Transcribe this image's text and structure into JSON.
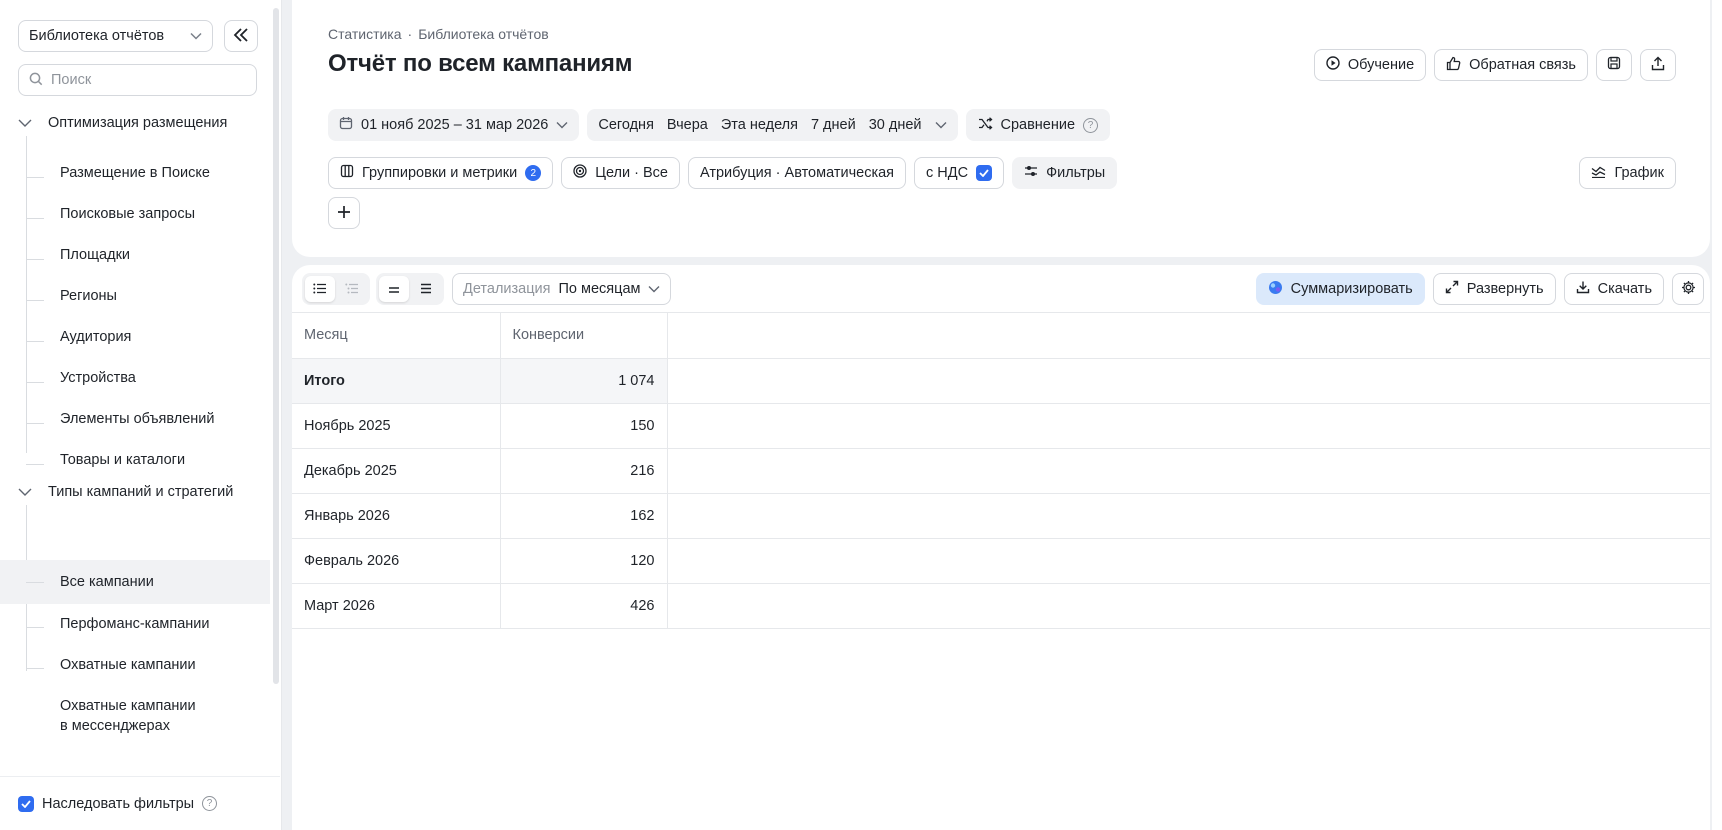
{
  "sidebar": {
    "library_select": "Библиотека отчётов",
    "search_placeholder": "Поиск",
    "groups": [
      {
        "title": "Оптимизация размещения",
        "items": [
          "Размещение в Поиске",
          "Поисковые запросы",
          "Площадки",
          "Регионы",
          "Аудитория",
          "Устройства",
          "Элементы объявлений",
          "Товары и каталоги"
        ]
      },
      {
        "title": "Типы кампаний и стратегий",
        "items": [
          "Все кампании",
          "Перфоманс-кампании",
          "Охватные кампании",
          "Охватные кампании в мессенджерах"
        ],
        "active_item": "Все кампании"
      }
    ],
    "item_multiline": [
      "Охватные кампании",
      "в мессенджерах"
    ],
    "footer_label": "Наследовать фильтры"
  },
  "header": {
    "breadcrumb": [
      "Статистика",
      "·",
      "Библиотека отчётов"
    ],
    "title": "Отчёт по всем кампаниям",
    "actions": {
      "learn": "Обучение",
      "feedback": "Обратная связь"
    },
    "date_range": "01 нояб 2025 – 31 мар 2026",
    "presets": [
      "Сегодня",
      "Вчера",
      "Эта неделя",
      "7 дней",
      "30 дней"
    ],
    "compare": "Сравнение",
    "groupings": "Группировки и метрики",
    "groupings_count": "2",
    "goals": "Цели · Все",
    "attribution": "Атрибуция · Автоматическая",
    "vat": "с НДС",
    "filters": "Фильтры",
    "chart": "График"
  },
  "toolbar": {
    "detail_label": "Детализация",
    "detail_value": "По месяцам",
    "summarize": "Суммаризировать",
    "expand": "Развернуть",
    "download": "Скачать"
  },
  "table": {
    "columns": [
      "Месяц",
      "Конверсии"
    ],
    "total": {
      "label": "Итого",
      "value": "1 074"
    },
    "rows": [
      {
        "month": "Ноябрь 2025",
        "value": "150"
      },
      {
        "month": "Декабрь 2025",
        "value": "216"
      },
      {
        "month": "Январь 2026",
        "value": "162"
      },
      {
        "month": "Февраль 2026",
        "value": "120"
      },
      {
        "month": "Март 2026",
        "value": "426"
      }
    ]
  },
  "colors": {
    "accent": "#2f6cf0",
    "summarize_bg": "#dbe9fb",
    "page_bg": "#eef0f3"
  }
}
